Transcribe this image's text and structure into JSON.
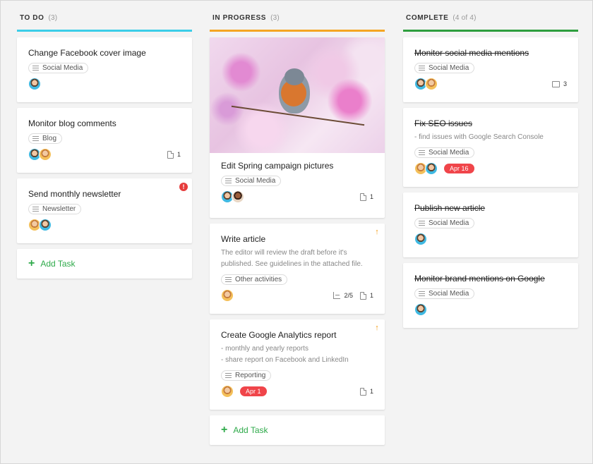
{
  "columns": [
    {
      "title": "TO DO",
      "count": "(3)",
      "accent": "#3ccde8",
      "cards": [
        {
          "title": "Change Facebook cover image",
          "tag": "Social Media"
        },
        {
          "title": "Monitor blog comments",
          "tag": "Blog",
          "attachments": "1"
        },
        {
          "title": "Send monthly newsletter",
          "tag": "Newsletter"
        }
      ],
      "add_task": "Add Task"
    },
    {
      "title": "IN PROGRESS",
      "count": "(3)",
      "accent": "#f5a623",
      "cards": [
        {
          "title": "Edit Spring campaign pictures",
          "tag": "Social Media",
          "attachments": "1"
        },
        {
          "title": "Write article",
          "description": "The editor will review the draft before it's published. See guidelines in the attached file.",
          "tag": "Other activities",
          "subtasks": "2/5",
          "attachments": "1"
        },
        {
          "title": "Create Google Analytics report",
          "description_lines": [
            "- monthly and yearly reports",
            "- share report on Facebook and LinkedIn"
          ],
          "tag": "Reporting",
          "due": "Apr 1",
          "attachments": "1"
        }
      ],
      "add_task": "Add Task"
    },
    {
      "title": "COMPLETE",
      "count": "(4 of 4)",
      "accent": "#2e9e3e",
      "cards": [
        {
          "title": "Monitor social media mentions",
          "tag": "Social Media",
          "comments": "3"
        },
        {
          "title": "Fix SEO issues",
          "description": "- find issues with Google Search Console",
          "tag": "Social Media",
          "due": "Apr 16"
        },
        {
          "title": "Publish new article",
          "tag": "Social Media"
        },
        {
          "title": "Monitor brand mentions on Google",
          "tag": "Social Media"
        }
      ]
    }
  ],
  "colors": {
    "add_task": "#2eaa4a",
    "due_badge": "#f0454a",
    "priority_high": "#e63c3c",
    "priority_up": "#f39c12"
  },
  "icons": {
    "alert": "!",
    "arrow_up": "↑",
    "plus": "+"
  }
}
